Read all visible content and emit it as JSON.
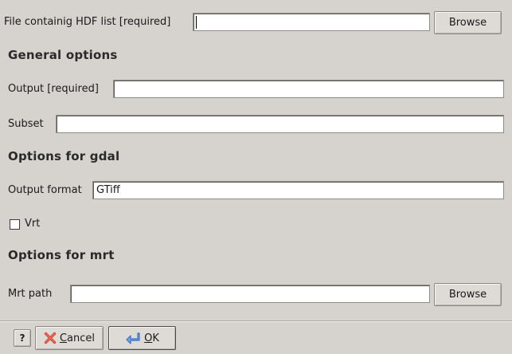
{
  "form": {
    "hdf_list": {
      "label": "File containig HDF list [required]",
      "value": "",
      "browse_label": "Browse"
    },
    "general_options": {
      "heading": "General options",
      "output": {
        "label": "Output [required]",
        "value": ""
      },
      "subset": {
        "label": "Subset",
        "value": ""
      }
    },
    "gdal_options": {
      "heading": "Options for gdal",
      "output_format": {
        "label": "Output format",
        "value": "GTiff"
      },
      "vrt": {
        "label": "Vrt",
        "checked": false
      }
    },
    "mrt_options": {
      "heading": "Options for mrt",
      "mrt_path": {
        "label": "Mrt path",
        "value": "",
        "browse_label": "Browse"
      }
    }
  },
  "footer": {
    "help_label": "?",
    "cancel_label": "Cancel",
    "cancel_mnemonic": "C",
    "cancel_rest": "ancel",
    "ok_label": "OK",
    "ok_mnemonic": "O",
    "ok_rest": "K"
  },
  "colors": {
    "window_bg": "#d6d2ce",
    "cancel_icon": "#d43a2a",
    "ok_icon": "#3a6fc4"
  }
}
